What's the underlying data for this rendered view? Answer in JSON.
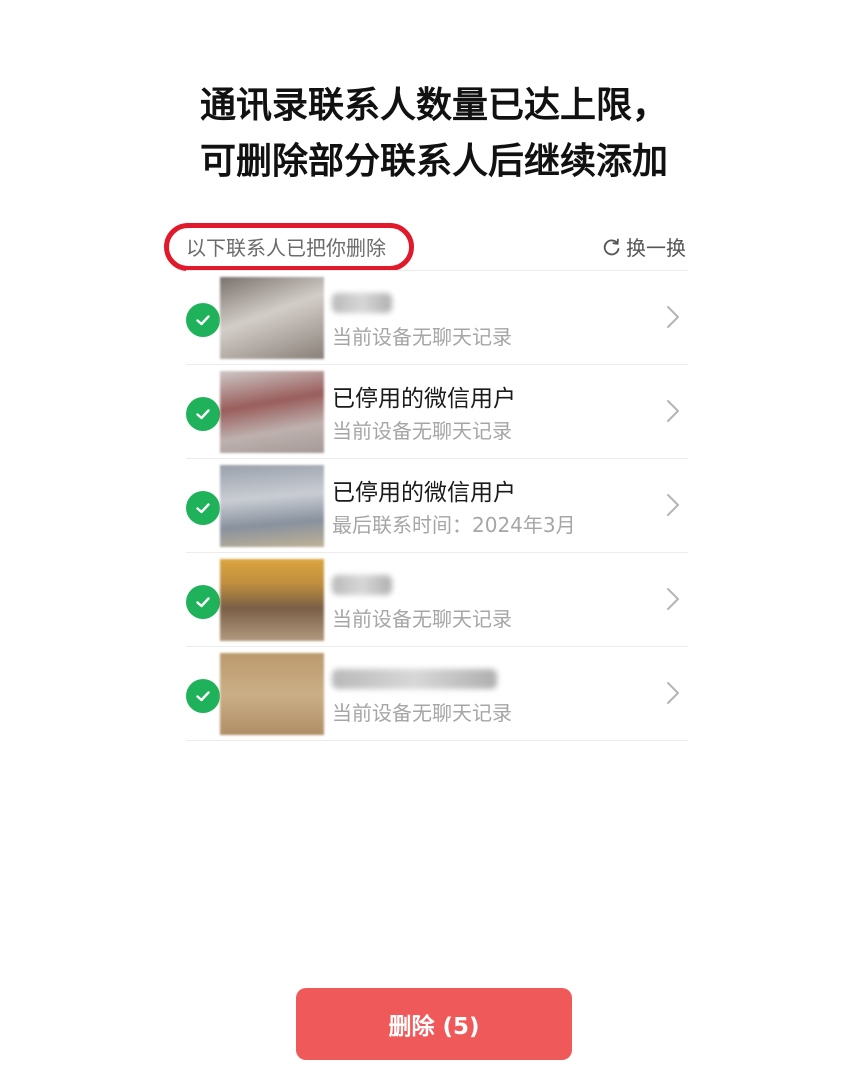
{
  "title": {
    "line1": "通讯录联系人数量已达上限，",
    "line2": "可删除部分联系人后继续添加"
  },
  "list_header": {
    "label": "以下联系人已把你删除",
    "refresh_label": "换一换",
    "refresh_icon": "refresh-icon",
    "highlight_color": "#e0192b"
  },
  "contacts": [
    {
      "name": "",
      "subtitle": "当前设备无聊天记录",
      "selected": true
    },
    {
      "name": "已停用的微信用户",
      "subtitle": "当前设备无聊天记录",
      "selected": true
    },
    {
      "name": "已停用的微信用户",
      "subtitle": "最后联系时间：2024年3月",
      "selected": true
    },
    {
      "name": "",
      "subtitle": "当前设备无聊天记录",
      "selected": true
    },
    {
      "name": "",
      "subtitle": "当前设备无聊天记录",
      "selected": true
    }
  ],
  "icons": {
    "check": "check-circle-icon",
    "chevron": "chevron-right-icon"
  },
  "colors": {
    "check_green": "#1fb25a",
    "button_red": "#f0595a"
  },
  "delete_button": {
    "label": "删除 (5)"
  }
}
